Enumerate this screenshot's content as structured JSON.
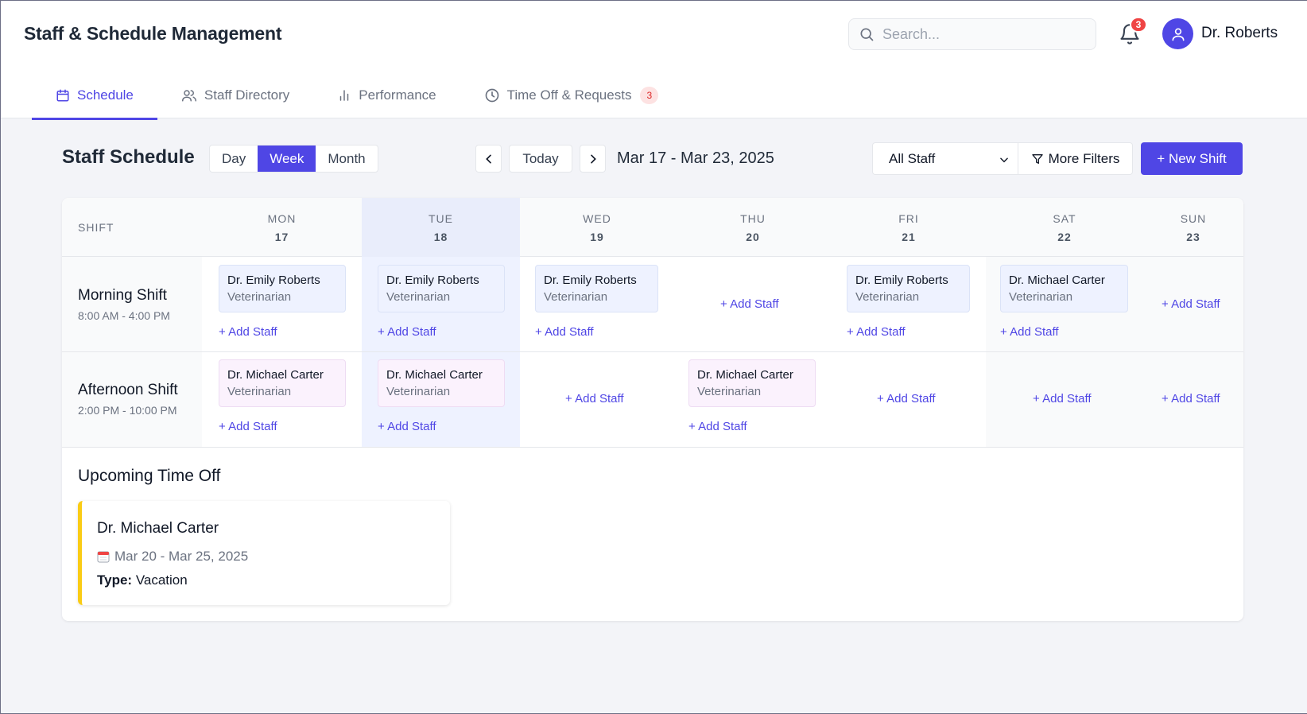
{
  "app": {
    "title": "Staff & Schedule Management"
  },
  "search": {
    "placeholder": "Search..."
  },
  "notifications": {
    "count": "3"
  },
  "user": {
    "name": "Dr. Roberts"
  },
  "tabs": [
    {
      "label": "Schedule",
      "icon": "calendar-icon",
      "active": true
    },
    {
      "label": "Staff Directory",
      "icon": "users-icon"
    },
    {
      "label": "Performance",
      "icon": "bar-chart-icon"
    },
    {
      "label": "Time Off & Requests",
      "icon": "clock-icon",
      "badge": "3"
    }
  ],
  "toolbar": {
    "title": "Staff Schedule",
    "views": [
      "Day",
      "Week",
      "Month"
    ],
    "active_view": "Week",
    "today_label": "Today",
    "date_range": "Mar 17 - Mar 23, 2025",
    "staff_filter": "All Staff",
    "more_filters": "More Filters",
    "new_shift": "+ New Shift"
  },
  "colors": {
    "accent": "#4f46e5",
    "highlight_day": "#eef2ff",
    "timeoff_border": "#facc15",
    "badge": "#ef4444"
  },
  "grid": {
    "shift_header": "SHIFT",
    "days": [
      {
        "name": "MON",
        "date": "17"
      },
      {
        "name": "TUE",
        "date": "18"
      },
      {
        "name": "WED",
        "date": "19"
      },
      {
        "name": "THU",
        "date": "20"
      },
      {
        "name": "FRI",
        "date": "21"
      },
      {
        "name": "SAT",
        "date": "22"
      },
      {
        "name": "SUN",
        "date": "23"
      }
    ],
    "add_label": "+ Add Staff",
    "shifts": [
      {
        "name": "Morning Shift",
        "time": "8:00 AM - 4:00 PM"
      },
      {
        "name": "Afternoon Shift",
        "time": "2:00 PM - 10:00 PM"
      }
    ],
    "assignments": {
      "morning": [
        {
          "name": "Dr. Emily Roberts",
          "role": "Veterinarian"
        },
        {
          "name": "Dr. Emily Roberts",
          "role": "Veterinarian"
        },
        {
          "name": "Dr. Emily Roberts",
          "role": "Veterinarian"
        },
        null,
        {
          "name": "Dr. Emily Roberts",
          "role": "Veterinarian"
        },
        {
          "name": "Dr. Michael Carter",
          "role": "Veterinarian"
        },
        null
      ],
      "afternoon": [
        {
          "name": "Dr. Michael Carter",
          "role": "Veterinarian"
        },
        {
          "name": "Dr. Michael Carter",
          "role": "Veterinarian"
        },
        null,
        {
          "name": "Dr. Michael Carter",
          "role": "Veterinarian"
        },
        null,
        null,
        null
      ]
    }
  },
  "time_off": {
    "title": "Upcoming Time Off",
    "entries": [
      {
        "name": "Dr. Michael Carter",
        "dates": "Mar 20 - Mar 25, 2025",
        "type_label": "Type:",
        "type": "Vacation"
      }
    ]
  }
}
